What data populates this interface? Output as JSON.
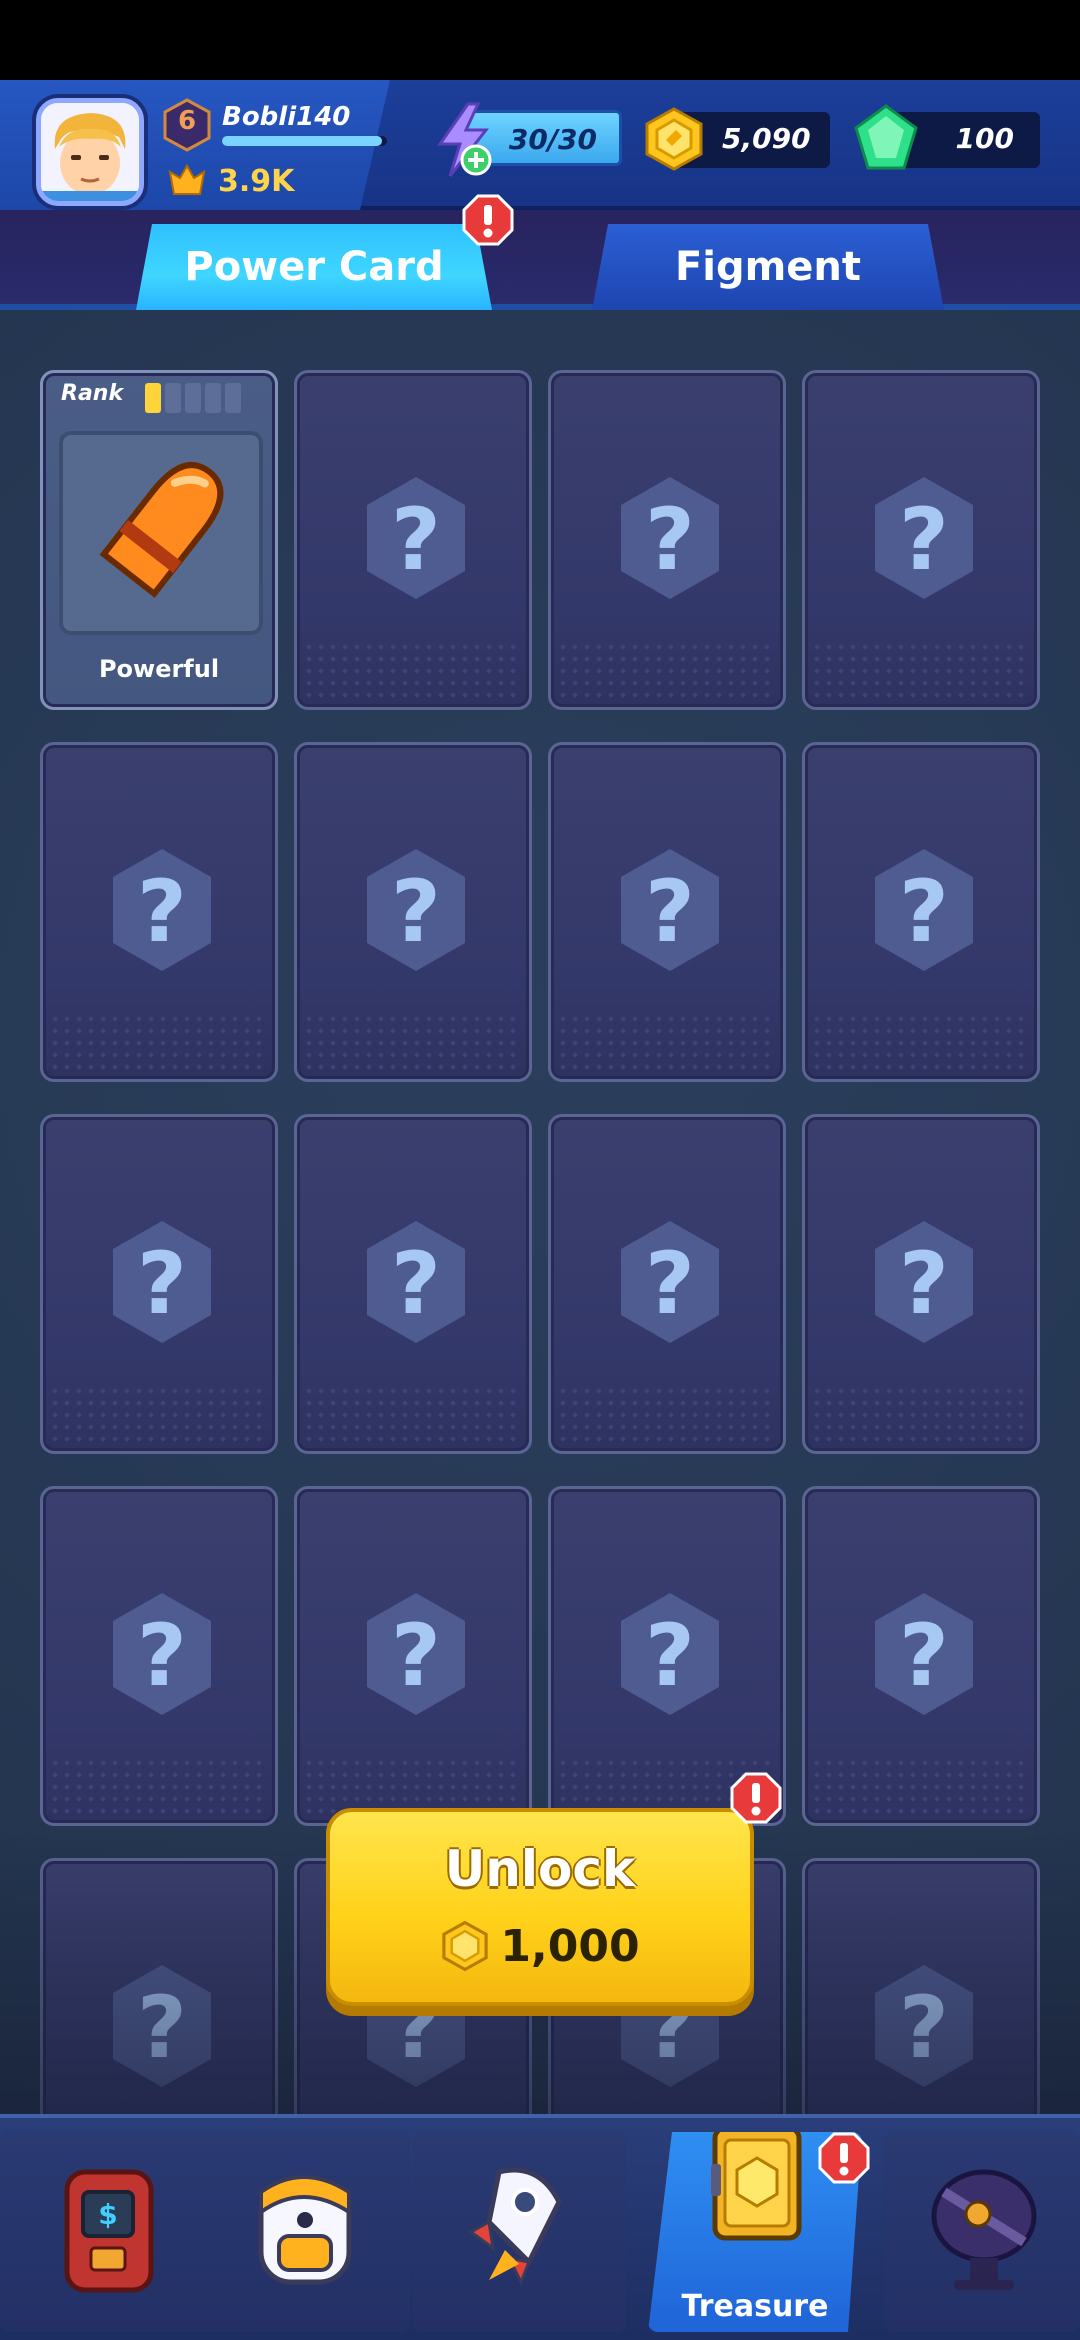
{
  "profile": {
    "name": "Bobli140",
    "level": "6",
    "power": "3.9K",
    "xp_progress": 0.97
  },
  "resources": {
    "energy": "30/30",
    "coins": "5,090",
    "gems": "100"
  },
  "tabs": [
    {
      "label": "Power Card",
      "active": true,
      "alert": true
    },
    {
      "label": "Figment",
      "active": false,
      "alert": false
    }
  ],
  "cards": {
    "first": {
      "rank_label": "Rank",
      "rank_filled": 1,
      "rank_total": 5,
      "name": "Powerful"
    },
    "locked_symbol": "?"
  },
  "unlock": {
    "label": "Unlock",
    "cost": "1,000",
    "alert": true
  },
  "bottom_nav": [
    {
      "icon": "vending-machine-icon",
      "label": "",
      "active": false
    },
    {
      "icon": "backpack-icon",
      "label": "",
      "active": false
    },
    {
      "icon": "rocket-icon",
      "label": "",
      "active": false
    },
    {
      "icon": "treasure-book-icon",
      "label": "Treasure",
      "active": true,
      "alert": true
    },
    {
      "icon": "radar-dish-icon",
      "label": "",
      "active": false
    }
  ],
  "colors": {
    "accent_cyan": "#3fd6ff",
    "gold": "#ffd21a",
    "alert_red": "#e83a3a"
  }
}
